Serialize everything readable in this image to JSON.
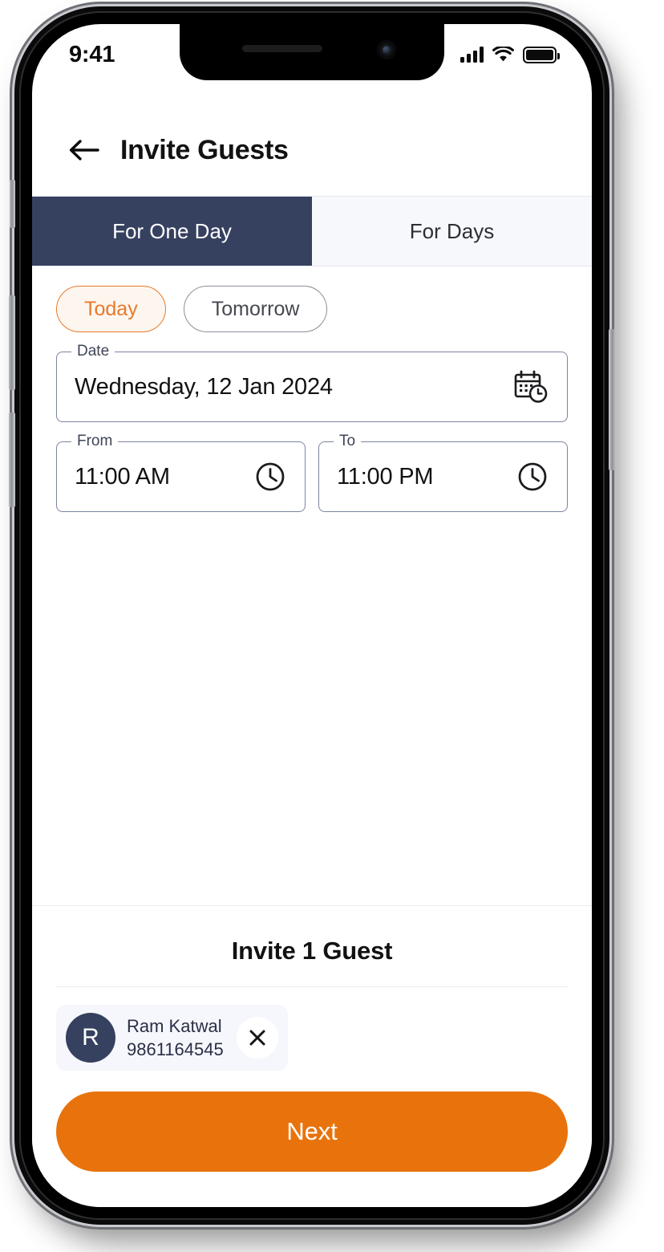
{
  "status_bar": {
    "time": "9:41",
    "signal_icon": "signal-bars-icon",
    "wifi_icon": "wifi-icon",
    "battery_icon": "battery-full-icon"
  },
  "header": {
    "back_icon": "back-arrow-icon",
    "title": "Invite Guests"
  },
  "tabs": [
    {
      "label": "For One Day",
      "active": true
    },
    {
      "label": "For Days",
      "active": false
    }
  ],
  "day_chips": [
    {
      "label": "Today",
      "selected": true
    },
    {
      "label": "Tomorrow",
      "selected": false
    }
  ],
  "fields": {
    "date": {
      "legend": "Date",
      "value": "Wednesday, 12 Jan 2024",
      "icon": "calendar-clock-icon"
    },
    "from": {
      "legend": "From",
      "value": "11:00 AM",
      "icon": "clock-icon"
    },
    "to": {
      "legend": "To",
      "value": "11:00 PM",
      "icon": "clock-icon"
    }
  },
  "bottom": {
    "invite_heading": "Invite 1 Guest",
    "guests": [
      {
        "initial": "R",
        "name": "Ram Katwal",
        "phone": "9861164545",
        "remove_icon": "close-icon"
      }
    ],
    "next_label": "Next"
  },
  "colors": {
    "accent_orange": "#e8730d",
    "tab_navy": "#36405f",
    "chip_selected_bg": "#fdf6ef",
    "avatar_navy": "#36405f"
  }
}
